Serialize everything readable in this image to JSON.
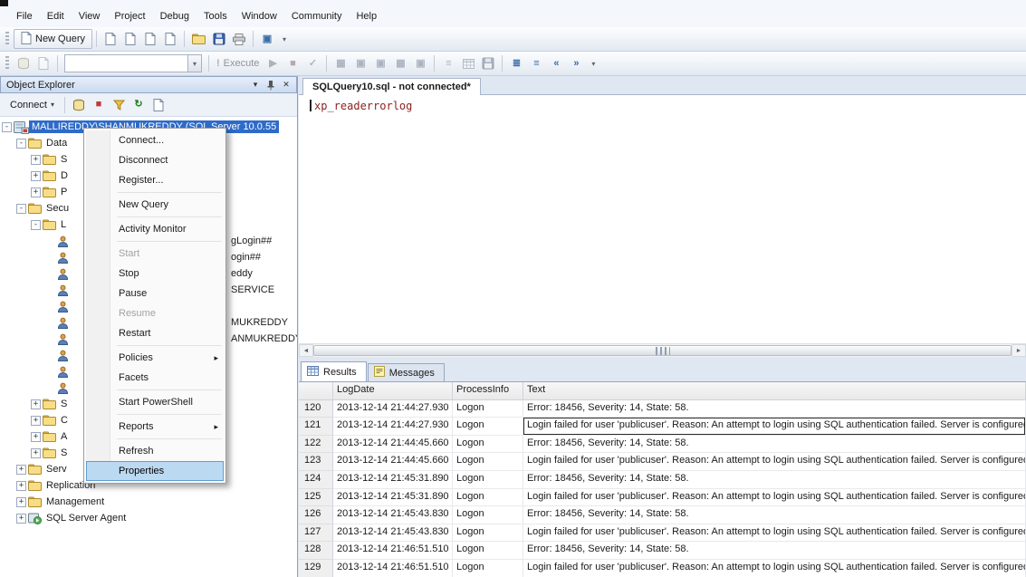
{
  "menubar": {
    "items": [
      "File",
      "Edit",
      "View",
      "Project",
      "Debug",
      "Tools",
      "Window",
      "Community",
      "Help"
    ]
  },
  "standard_toolbar": {
    "new_query_label": "New Query",
    "query_icons": [
      "database-engine-query-icon",
      "analysis-services-mdx-query-icon",
      "analysis-services-dmx-query-icon",
      "analysis-services-xmla-query-icon"
    ],
    "file_icons": [
      "open-file-icon",
      "save-icon",
      "print-icon"
    ],
    "extra_icons": [
      "activity-monitor-icon"
    ]
  },
  "sql_toolbar": {
    "connection_icons": [
      "change-connection-icon",
      "change-database-icon"
    ],
    "database_combo": {
      "value": ""
    },
    "execute_label": "Execute",
    "execute_enabled": false,
    "exec_icons": [
      "debug-icon",
      "cancel-executing-query-icon",
      "parse-icon"
    ],
    "query_option_icons": [
      "show-estimated-plan-icon",
      "query-options-icon",
      "intellisense-icon",
      "include-actual-plan-icon",
      "include-client-statistics-icon"
    ],
    "results_icons": [
      "results-to-text-icon",
      "results-to-grid-icon",
      "results-to-file-icon"
    ],
    "edit_icons": [
      "comment-out-icon",
      "uncomment-icon",
      "decrease-indent-icon",
      "increase-indent-icon"
    ]
  },
  "object_explorer": {
    "title": "Object Explorer",
    "connect_label": "Connect",
    "toolbar_icons": [
      "disconnect-icon",
      "stop-icon",
      "filter-icon",
      "refresh-icon",
      "script-icon"
    ],
    "tree": [
      {
        "level": 0,
        "expand": "-",
        "icon": "server",
        "label": "MALLIREDDY\\SHANMUKREDDY (SQL Server 10.0.55",
        "selected": true
      },
      {
        "level": 1,
        "expand": "-",
        "icon": "folder",
        "label": "Data"
      },
      {
        "level": 2,
        "expand": "+",
        "icon": "folder",
        "label": "S"
      },
      {
        "level": 2,
        "expand": "+",
        "icon": "folder",
        "label": "D"
      },
      {
        "level": 2,
        "expand": "+",
        "icon": "folder",
        "label": "P"
      },
      {
        "level": 1,
        "expand": "-",
        "icon": "folder",
        "label": "Secu"
      },
      {
        "level": 2,
        "expand": "-",
        "icon": "folder",
        "label": "L"
      },
      {
        "level": 3,
        "icon": "user",
        "label": "gLogin##",
        "label_offset": 172
      },
      {
        "level": 3,
        "icon": "user",
        "label": "ogin##",
        "label_offset": 172
      },
      {
        "level": 3,
        "icon": "user",
        "label": "eddy",
        "label_offset": 172
      },
      {
        "level": 3,
        "icon": "user",
        "label": "SERVICE",
        "label_offset": 172
      },
      {
        "level": 3,
        "icon": "user",
        "label": ""
      },
      {
        "level": 3,
        "icon": "user",
        "label": "MUKREDDY",
        "label_offset": 172
      },
      {
        "level": 3,
        "icon": "user",
        "label": "ANMUKREDDY",
        "label_offset": 172
      },
      {
        "level": 3,
        "icon": "user",
        "label": ""
      },
      {
        "level": 3,
        "icon": "user",
        "label": ""
      },
      {
        "level": 3,
        "icon": "user",
        "label": ""
      },
      {
        "level": 2,
        "expand": "+",
        "icon": "folder",
        "label": "S"
      },
      {
        "level": 2,
        "expand": "+",
        "icon": "folder",
        "label": "C"
      },
      {
        "level": 2,
        "expand": "+",
        "icon": "folder",
        "label": "A"
      },
      {
        "level": 2,
        "expand": "+",
        "icon": "folder",
        "label": "S"
      },
      {
        "level": 1,
        "expand": "+",
        "icon": "folder",
        "label": "Serv"
      },
      {
        "level": 1,
        "expand": "+",
        "icon": "folder",
        "label": "Replication"
      },
      {
        "level": 1,
        "expand": "+",
        "icon": "folder",
        "label": "Management"
      },
      {
        "level": 1,
        "expand": "+",
        "icon": "agent",
        "label": "SQL Server Agent"
      }
    ]
  },
  "context_menu": {
    "items": [
      {
        "label": "Connect..."
      },
      {
        "label": "Disconnect"
      },
      {
        "label": "Register..."
      },
      {
        "type": "separator"
      },
      {
        "label": "New Query"
      },
      {
        "type": "separator"
      },
      {
        "label": "Activity Monitor"
      },
      {
        "type": "separator"
      },
      {
        "label": "Start",
        "disabled": true
      },
      {
        "label": "Stop"
      },
      {
        "label": "Pause"
      },
      {
        "label": "Resume",
        "disabled": true
      },
      {
        "label": "Restart"
      },
      {
        "type": "separator"
      },
      {
        "label": "Policies",
        "submenu": true
      },
      {
        "label": "Facets"
      },
      {
        "type": "separator"
      },
      {
        "label": "Start PowerShell"
      },
      {
        "type": "separator"
      },
      {
        "label": "Reports",
        "submenu": true
      },
      {
        "type": "separator"
      },
      {
        "label": "Refresh"
      },
      {
        "label": "Properties",
        "highlighted": true
      }
    ]
  },
  "editor": {
    "tab_title": "SQLQuery10.sql - not connected*",
    "code": "xp_readerrorlog"
  },
  "results_pane": {
    "tabs": [
      {
        "label": "Results",
        "active": true
      },
      {
        "label": "Messages",
        "active": false
      }
    ],
    "columns": [
      "LogDate",
      "ProcessInfo",
      "Text"
    ],
    "rows": [
      {
        "num": "120",
        "logdate": "2013-12-14 21:44:27.930",
        "process": "Logon",
        "text": "Error: 18456, Severity: 14, State: 58."
      },
      {
        "num": "121",
        "logdate": "2013-12-14 21:44:27.930",
        "process": "Logon",
        "text": "Login failed for user 'publicuser'. Reason: An attempt to login using SQL authentication failed. Server is configured for W",
        "focused": true
      },
      {
        "num": "122",
        "logdate": "2013-12-14 21:44:45.660",
        "process": "Logon",
        "text": "Error: 18456, Severity: 14, State: 58."
      },
      {
        "num": "123",
        "logdate": "2013-12-14 21:44:45.660",
        "process": "Logon",
        "text": "Login failed for user 'publicuser'. Reason: An attempt to login using SQL authentication failed. Server is configured for W"
      },
      {
        "num": "124",
        "logdate": "2013-12-14 21:45:31.890",
        "process": "Logon",
        "text": "Error: 18456, Severity: 14, State: 58."
      },
      {
        "num": "125",
        "logdate": "2013-12-14 21:45:31.890",
        "process": "Logon",
        "text": "Login failed for user 'publicuser'. Reason: An attempt to login using SQL authentication failed. Server is configured for W"
      },
      {
        "num": "126",
        "logdate": "2013-12-14 21:45:43.830",
        "process": "Logon",
        "text": "Error: 18456, Severity: 14, State: 58."
      },
      {
        "num": "127",
        "logdate": "2013-12-14 21:45:43.830",
        "process": "Logon",
        "text": "Login failed for user 'publicuser'. Reason: An attempt to login using SQL authentication failed. Server is configured for W"
      },
      {
        "num": "128",
        "logdate": "2013-12-14 21:46:51.510",
        "process": "Logon",
        "text": "Error: 18456, Severity: 14, State: 58."
      },
      {
        "num": "129",
        "logdate": "2013-12-14 21:46:51.510",
        "process": "Logon",
        "text": "Login failed for user 'publicuser'. Reason: An attempt to login using SQL authentication failed. Server is configured for W"
      }
    ]
  },
  "colors": {
    "selection_blue": "#2e6bc8",
    "menu_highlight": "#bcd9f2",
    "code_maroon": "#8b1f1f"
  }
}
